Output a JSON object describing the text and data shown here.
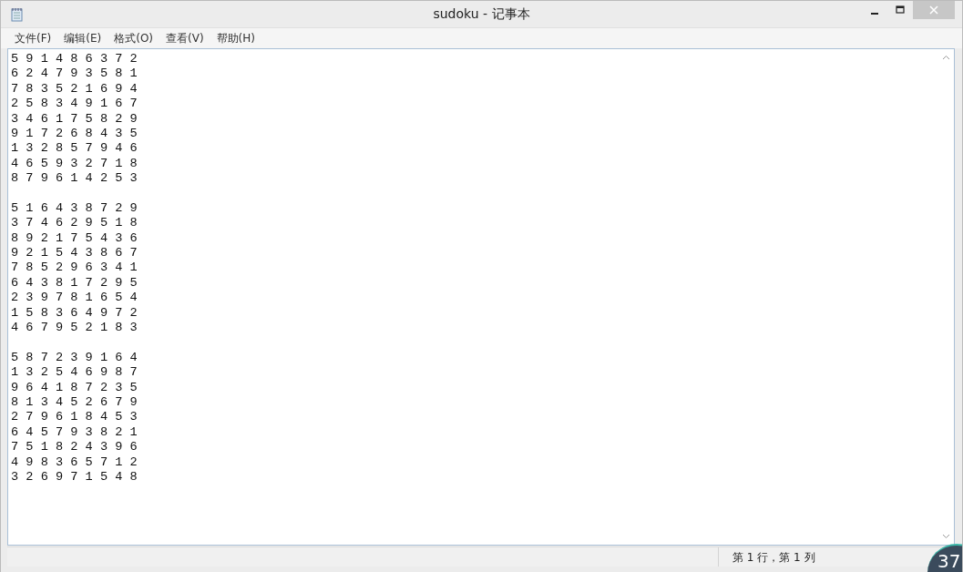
{
  "window": {
    "title": "sudoku - 记事本"
  },
  "menu": [
    {
      "label": "文件(F)"
    },
    {
      "label": "编辑(E)"
    },
    {
      "label": "格式(O)"
    },
    {
      "label": "查看(V)"
    },
    {
      "label": "帮助(H)"
    }
  ],
  "editor": {
    "blocks": [
      {
        "rows": [
          "5 9 1 4 8 6 3 7 2",
          "6 2 4 7 9 3 5 8 1",
          "7 8 3 5 2 1 6 9 4",
          "2 5 8 3 4 9 1 6 7",
          "3 4 6 1 7 5 8 2 9",
          "9 1 7 2 6 8 4 3 5",
          "1 3 2 8 5 7 9 4 6",
          "4 6 5 9 3 2 7 1 8",
          "8 7 9 6 1 4 2 5 3"
        ]
      },
      {
        "rows": [
          "5 1 6 4 3 8 7 2 9",
          "3 7 4 6 2 9 5 1 8",
          "8 9 2 1 7 5 4 3 6",
          "9 2 1 5 4 3 8 6 7",
          "7 8 5 2 9 6 3 4 1",
          "6 4 3 8 1 7 2 9 5",
          "2 3 9 7 8 1 6 5 4",
          "1 5 8 3 6 4 9 7 2",
          "4 6 7 9 5 2 1 8 3"
        ]
      },
      {
        "rows": [
          "5 8 7 2 3 9 1 6 4",
          "1 3 2 5 4 6 9 8 7",
          "9 6 4 1 8 7 2 3 5",
          "8 1 3 4 5 2 6 7 9",
          "2 7 9 6 1 8 4 5 3",
          "6 4 5 7 9 3 8 2 1",
          "7 5 1 8 2 4 3 9 6",
          "4 9 8 3 6 5 7 1 2",
          "3 2 6 9 7 1 5 4 8"
        ]
      }
    ]
  },
  "status_bar": {
    "position": "第 1 行，第 1 列"
  },
  "overlay_badge": {
    "text": "37"
  }
}
